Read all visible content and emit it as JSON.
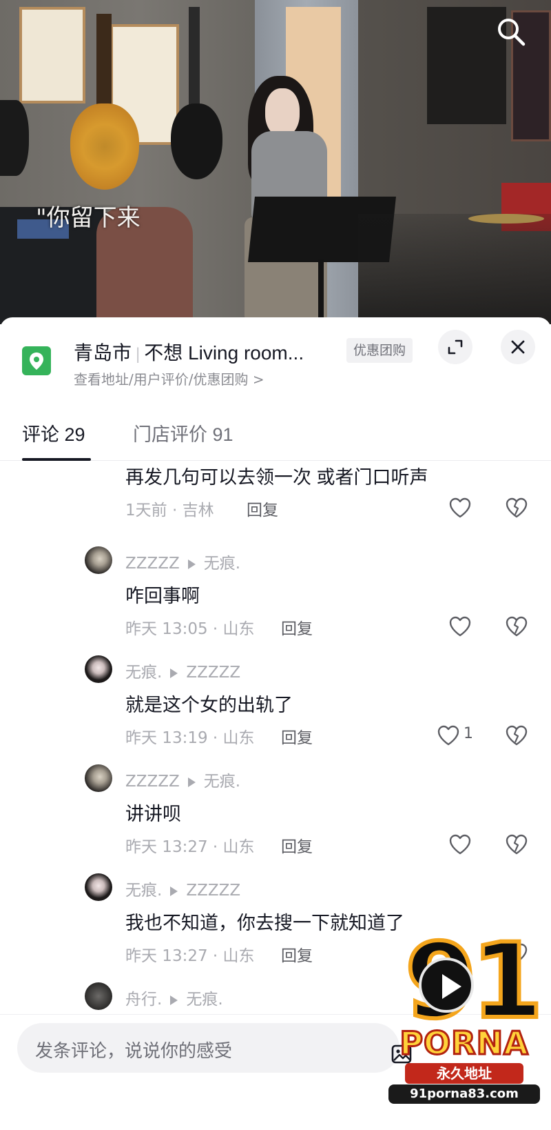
{
  "video": {
    "caption": "\"你留下来",
    "search_icon": "search-icon"
  },
  "poi": {
    "city": "青岛市",
    "name": "不想 Living room...",
    "tag": "优惠团购",
    "subtitle": "查看地址/用户评价/优惠团购 >",
    "icons": {
      "location": "location-pin-icon",
      "expand": "expand-icon",
      "close": "close-icon"
    },
    "accent_color": "#35b35a"
  },
  "tabs": [
    {
      "label": "评论 29",
      "active": true
    },
    {
      "label": "门店评价 91",
      "active": false
    }
  ],
  "comments": [
    {
      "text": "再发几句可以去领一次 或者门口听声",
      "time": "1天前 · 吉林",
      "reply": "回复",
      "likes": ""
    },
    {
      "author": "ZZZZZ",
      "reply_to": "无痕.",
      "text": "咋回事啊",
      "time": "昨天 13:05 · 山东",
      "reply": "回复",
      "likes": ""
    },
    {
      "author": "无痕.",
      "reply_to": "ZZZZZ",
      "text": "就是这个女的出轨了",
      "time": "昨天 13:19 · 山东",
      "reply": "回复",
      "likes": "1"
    },
    {
      "author": "ZZZZZ",
      "reply_to": "无痕.",
      "text": "讲讲呗",
      "time": "昨天 13:27 · 山东",
      "reply": "回复",
      "likes": ""
    },
    {
      "author": "无痕.",
      "reply_to": "ZZZZZ",
      "text": "我也不知道，你去搜一下就知道了",
      "time": "昨天 13:27 · 山东",
      "reply": "回复",
      "likes": ""
    },
    {
      "author": "舟行.",
      "reply_to": "无痕."
    }
  ],
  "input": {
    "placeholder": "发条评论，说说你的感受"
  },
  "watermark": {
    "number": "91",
    "brand": "PORNA",
    "tagline": "永久地址",
    "url": "91porna83.com"
  }
}
